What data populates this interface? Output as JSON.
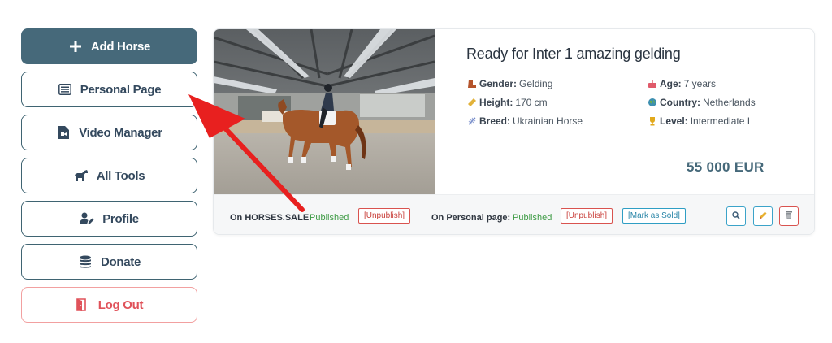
{
  "sidebar": {
    "add_horse": "Add Horse",
    "personal_page": "Personal Page",
    "video_manager": "Video Manager",
    "all_tools": "All Tools",
    "profile": "Profile",
    "donate": "Donate",
    "log_out": "Log Out"
  },
  "listing": {
    "title": "Ready for Inter 1 amazing gelding",
    "gender_label": "Gender:",
    "gender": "Gelding",
    "age_label": "Age:",
    "age": "7 years",
    "height_label": "Height:",
    "height": "170 cm",
    "country_label": "Country:",
    "country": "Netherlands",
    "breed_label": "Breed:",
    "breed": "Ukrainian Horse",
    "level_label": "Level:",
    "level": "Intermediate I",
    "price": "55 000 EUR"
  },
  "footer": {
    "horses_sale_label": "On HORSES.SALE:",
    "horses_sale_status": "Published",
    "unpublish_1": "[Unpublish]",
    "personal_label": "On Personal page:",
    "personal_status": "Published",
    "unpublish_2": "[Unpublish]",
    "mark_sold": "[Mark as Sold]"
  },
  "colors": {
    "primary": "#46697a",
    "published": "#3e9b45",
    "danger": "#d9534f",
    "info": "#2f9ec4",
    "annotation_arrow": "#e8201f"
  },
  "icons": [
    "plus-icon",
    "list-icon",
    "video-file-icon",
    "horse-icon",
    "user-edit-icon",
    "coins-icon",
    "logout-door-icon",
    "search-icon",
    "pencil-icon",
    "trash-icon"
  ]
}
